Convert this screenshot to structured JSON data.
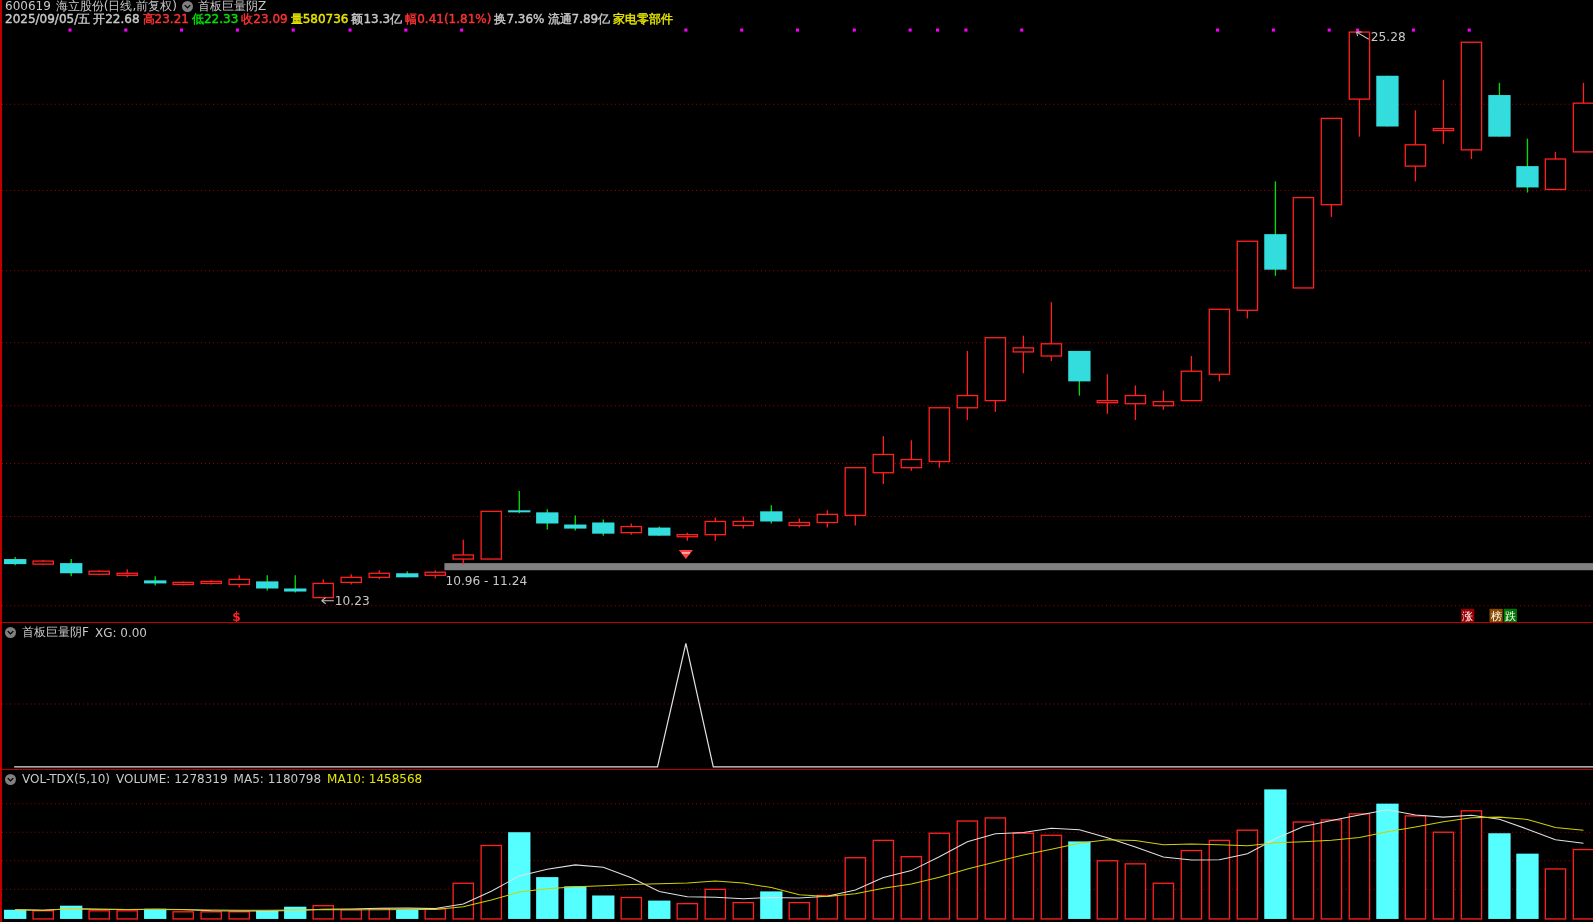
{
  "title_line": {
    "code": "600619",
    "name": "海立股份(日线,前复权)",
    "indicator": "首板巨量阴Z"
  },
  "quote": [
    {
      "text": "2025/09/05/五",
      "color": "#c8c8c8"
    },
    {
      "text": "开22.68",
      "color": "#c8c8c8"
    },
    {
      "text": "高23.21",
      "color": "#ff3232"
    },
    {
      "text": "低22.33",
      "color": "#00e600"
    },
    {
      "text": "收23.09",
      "color": "#ff3232"
    },
    {
      "text": "量580736",
      "color": "#e6e600"
    },
    {
      "text": "额13.3亿",
      "color": "#c8c8c8"
    },
    {
      "text": "幅0.41(1.81%)",
      "color": "#ff3232"
    },
    {
      "text": "换7.36%",
      "color": "#c8c8c8"
    },
    {
      "text": "流通7.89亿",
      "color": "#c8c8c8"
    },
    {
      "text": "家电零部件",
      "color": "#e6e600"
    }
  ],
  "main_chart": {
    "high_label": "25.28",
    "low_label": "10.23",
    "range_label": "10.96 - 11.24",
    "signal_mark": "$",
    "badges": [
      {
        "text": "涨",
        "color": "#9b0000"
      },
      {
        "text": "榜",
        "color": "#8b4a00"
      },
      {
        "text": "跌",
        "color": "#007a00"
      }
    ]
  },
  "indicator_panel": {
    "name": "首板巨量阴F",
    "reading": "XG: 0.00"
  },
  "volume_panel": {
    "name": "VOL-TDX(5,10)",
    "volume": "VOLUME: 1278319",
    "ma5": "MA5: 1180798",
    "ma10": "MA10: 1458568"
  }
}
